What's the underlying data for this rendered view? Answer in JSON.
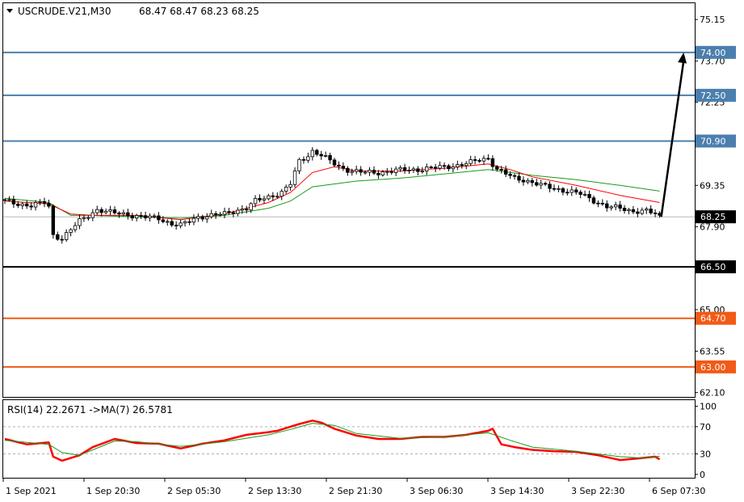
{
  "header": {
    "symbol": "USCRUDE.V21,M30",
    "ohlc": "68.47 68.47 68.23 68.25"
  },
  "colors": {
    "bg": "#ffffff",
    "frame": "#000000",
    "blue_line": "#4b7fae",
    "black_line": "#000000",
    "orange_line": "#f25a16",
    "ma_fast": "#ff0000",
    "ma_slow": "#1a9a1a",
    "rsi_line": "#ff0000",
    "rsi_ma": "#1a9a1a",
    "bull_fill": "#ffffff",
    "bear_fill": "#000000"
  },
  "chart_data": [
    {
      "type": "candlestick",
      "y_ticks": [
        "75.15",
        "73.70",
        "72.25",
        "69.35",
        "67.90",
        "65.00",
        "63.55",
        "62.10"
      ],
      "ylim": [
        61.95,
        75.72
      ],
      "x_labels": [
        "1 Sep 2021",
        "1 Sep 20:30",
        "2 Sep 05:30",
        "2 Sep 13:30",
        "2 Sep 21:30",
        "3 Sep 06:30",
        "3 Sep 14:30",
        "3 Sep 22:30",
        "6 Sep 07:30"
      ],
      "current_price": {
        "value": 68.25,
        "label": "68.25"
      },
      "levels": [
        {
          "value": 74.0,
          "label": "74.00",
          "color": "blue"
        },
        {
          "value": 72.5,
          "label": "72.50",
          "color": "blue"
        },
        {
          "value": 70.9,
          "label": "70.90",
          "color": "blue"
        },
        {
          "value": 66.5,
          "label": "66.50",
          "color": "black"
        },
        {
          "value": 64.7,
          "label": "64.70",
          "color": "orange"
        },
        {
          "value": 63.0,
          "label": "63.00",
          "color": "orange"
        }
      ],
      "close_path": [
        [
          0,
          68.8
        ],
        [
          3,
          68.7
        ],
        [
          6,
          68.65
        ],
        [
          9,
          68.75
        ],
        [
          10,
          68.6
        ],
        [
          11,
          67.6
        ],
        [
          13,
          67.5
        ],
        [
          15,
          67.8
        ],
        [
          17,
          68.1
        ],
        [
          19,
          68.3
        ],
        [
          21,
          68.5
        ],
        [
          24,
          68.4
        ],
        [
          27,
          68.35
        ],
        [
          31,
          68.25
        ],
        [
          35,
          68.2
        ],
        [
          38,
          68.0
        ],
        [
          40,
          67.95
        ],
        [
          42,
          68.1
        ],
        [
          44,
          68.25
        ],
        [
          47,
          68.3
        ],
        [
          50,
          68.35
        ],
        [
          52,
          68.45
        ],
        [
          55,
          68.55
        ],
        [
          57,
          68.8
        ],
        [
          59,
          68.9
        ],
        [
          61,
          69.0
        ],
        [
          63,
          69.1
        ],
        [
          65,
          69.4
        ],
        [
          66,
          69.8
        ],
        [
          67,
          70.2
        ],
        [
          69,
          70.4
        ],
        [
          70,
          70.55
        ],
        [
          72,
          70.4
        ],
        [
          74,
          70.2
        ],
        [
          76,
          70.0
        ],
        [
          79,
          69.85
        ],
        [
          82,
          69.8
        ],
        [
          85,
          69.8
        ],
        [
          88,
          69.85
        ],
        [
          91,
          69.9
        ],
        [
          94,
          69.9
        ],
        [
          97,
          69.95
        ],
        [
          100,
          70.0
        ],
        [
          103,
          70.05
        ],
        [
          106,
          70.15
        ],
        [
          108,
          70.25
        ],
        [
          110,
          70.3
        ],
        [
          112,
          69.9
        ],
        [
          114,
          69.75
        ],
        [
          116,
          69.6
        ],
        [
          118,
          69.55
        ],
        [
          120,
          69.45
        ],
        [
          122,
          69.35
        ],
        [
          125,
          69.25
        ],
        [
          128,
          69.15
        ],
        [
          131,
          69.05
        ],
        [
          133,
          68.9
        ],
        [
          135,
          68.75
        ],
        [
          137,
          68.6
        ],
        [
          140,
          68.55
        ],
        [
          143,
          68.45
        ],
        [
          146,
          68.45
        ],
        [
          148,
          68.35
        ],
        [
          149,
          68.25
        ]
      ],
      "ma_fast_path": [
        [
          0,
          68.8
        ],
        [
          10,
          68.7
        ],
        [
          15,
          68.35
        ],
        [
          20,
          68.3
        ],
        [
          30,
          68.3
        ],
        [
          40,
          68.15
        ],
        [
          50,
          68.35
        ],
        [
          60,
          68.75
        ],
        [
          65,
          69.1
        ],
        [
          70,
          69.8
        ],
        [
          75,
          70.0
        ],
        [
          80,
          69.85
        ],
        [
          90,
          69.85
        ],
        [
          100,
          69.95
        ],
        [
          110,
          70.1
        ],
        [
          115,
          69.9
        ],
        [
          120,
          69.65
        ],
        [
          130,
          69.35
        ],
        [
          140,
          69.0
        ],
        [
          149,
          68.75
        ]
      ],
      "ma_slow_path": [
        [
          0,
          68.9
        ],
        [
          10,
          68.75
        ],
        [
          15,
          68.3
        ],
        [
          20,
          68.3
        ],
        [
          30,
          68.25
        ],
        [
          40,
          68.2
        ],
        [
          50,
          68.3
        ],
        [
          60,
          68.55
        ],
        [
          65,
          68.8
        ],
        [
          70,
          69.3
        ],
        [
          80,
          69.5
        ],
        [
          90,
          69.6
        ],
        [
          100,
          69.75
        ],
        [
          110,
          69.9
        ],
        [
          120,
          69.7
        ],
        [
          130,
          69.55
        ],
        [
          140,
          69.35
        ],
        [
          149,
          69.15
        ]
      ],
      "arrow": {
        "from": [
          149,
          68.25
        ],
        "to": [
          153,
          74.0
        ]
      }
    },
    {
      "type": "line",
      "title": "RSI(14) 22.2671  ->MA(7) 26.5781",
      "y_ticks": [
        "100",
        "70",
        "30",
        "0"
      ],
      "ylim": [
        -5,
        109
      ],
      "guides": [
        70,
        30
      ],
      "series": [
        {
          "name": "RSI(14)",
          "values": [
            [
              0,
              52
            ],
            [
              5,
              44
            ],
            [
              10,
              47
            ],
            [
              11,
              26
            ],
            [
              13,
              20
            ],
            [
              17,
              28
            ],
            [
              20,
              40
            ],
            [
              25,
              52
            ],
            [
              30,
              46
            ],
            [
              35,
              45
            ],
            [
              40,
              38
            ],
            [
              45,
              45
            ],
            [
              50,
              50
            ],
            [
              55,
              58
            ],
            [
              60,
              62
            ],
            [
              62,
              64
            ],
            [
              65,
              70
            ],
            [
              67,
              74
            ],
            [
              70,
              79
            ],
            [
              72,
              76
            ],
            [
              75,
              67
            ],
            [
              80,
              57
            ],
            [
              85,
              52
            ],
            [
              90,
              52
            ],
            [
              95,
              55
            ],
            [
              100,
              55
            ],
            [
              105,
              58
            ],
            [
              110,
              64
            ],
            [
              111,
              67
            ],
            [
              113,
              44
            ],
            [
              116,
              40
            ],
            [
              120,
              36
            ],
            [
              125,
              34
            ],
            [
              130,
              33
            ],
            [
              135,
              28
            ],
            [
              140,
              21
            ],
            [
              145,
              24
            ],
            [
              148,
              26
            ],
            [
              149,
              22
            ]
          ]
        },
        {
          "name": "MA(7)",
          "values": [
            [
              0,
              50
            ],
            [
              10,
              44
            ],
            [
              13,
              32
            ],
            [
              17,
              28
            ],
            [
              20,
              36
            ],
            [
              25,
              49
            ],
            [
              30,
              48
            ],
            [
              40,
              41
            ],
            [
              50,
              48
            ],
            [
              60,
              58
            ],
            [
              65,
              66
            ],
            [
              70,
              75
            ],
            [
              75,
              72
            ],
            [
              80,
              60
            ],
            [
              90,
              53
            ],
            [
              100,
              55
            ],
            [
              110,
              61
            ],
            [
              115,
              50
            ],
            [
              120,
              40
            ],
            [
              130,
              34
            ],
            [
              140,
              26
            ],
            [
              145,
              24
            ],
            [
              149,
              26.6
            ]
          ]
        }
      ]
    }
  ]
}
